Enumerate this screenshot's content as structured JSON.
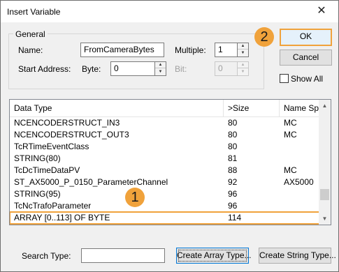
{
  "window": {
    "title": "Insert Variable",
    "close": "✕"
  },
  "general": {
    "legend": "General",
    "name_label": "Name:",
    "name_value": "FromCameraBytes",
    "multiple_label": "Multiple:",
    "multiple_value": "1",
    "start_address_label": "Start Address:",
    "byte_label": "Byte:",
    "byte_value": "0",
    "bit_label": "Bit:",
    "bit_value": "0"
  },
  "buttons": {
    "ok": "OK",
    "cancel": "Cancel",
    "create_array": "Create Array Type...",
    "create_string": "Create String Type..."
  },
  "show_all": {
    "label": "Show All",
    "checked": false
  },
  "table": {
    "columns": [
      "Data Type",
      ">Size",
      "Name Spac"
    ],
    "rows": [
      [
        "NCENCODERSTRUCT_IN3",
        "80",
        "MC"
      ],
      [
        "NCENCODERSTRUCT_OUT3",
        "80",
        "MC"
      ],
      [
        "TcRTimeEventClass",
        "80",
        ""
      ],
      [
        "STRING(80)",
        "81",
        ""
      ],
      [
        "TcDcTimeDataPV",
        "88",
        "MC"
      ],
      [
        "ST_AX5000_P_0150_ParameterChannel",
        "92",
        "AX5000"
      ],
      [
        "STRING(95)",
        "96",
        ""
      ],
      [
        "TcNcTrafoParameter",
        "96",
        ""
      ],
      [
        "ARRAY [0..113] OF BYTE",
        "114",
        ""
      ]
    ],
    "selected_index": 8
  },
  "search": {
    "label": "Search Type:",
    "value": ""
  },
  "badges": {
    "step1": "1",
    "step2": "2"
  },
  "colors": {
    "highlight": "#f0a23b"
  }
}
